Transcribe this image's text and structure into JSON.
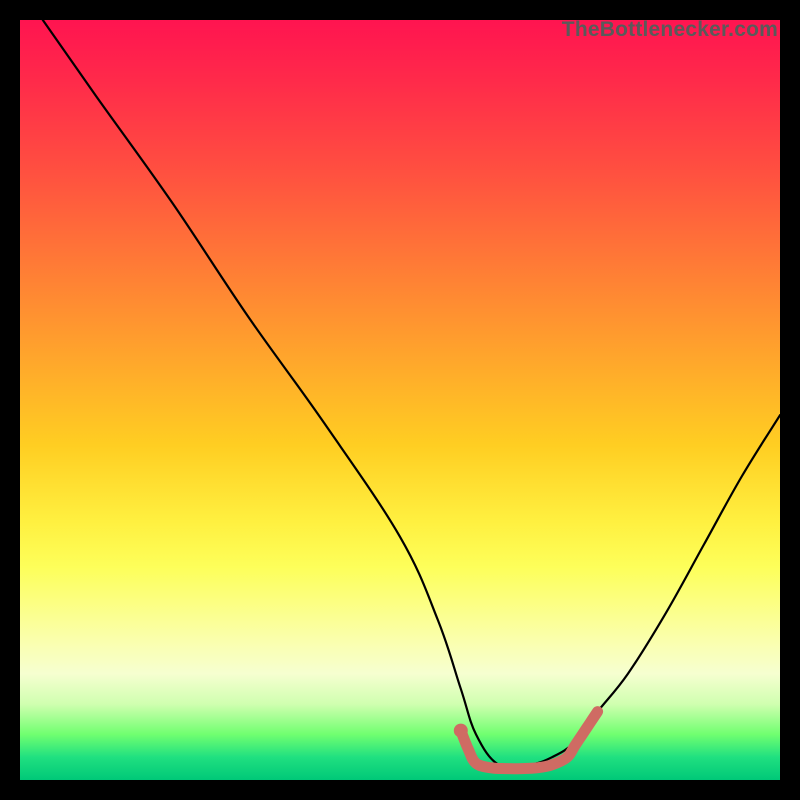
{
  "watermark": "TheBottleneсker.com",
  "chart_data": {
    "type": "line",
    "title": "",
    "xlabel": "",
    "ylabel": "",
    "xlim": [
      0,
      100
    ],
    "ylim": [
      0,
      100
    ],
    "series": [
      {
        "name": "curve",
        "x": [
          3,
          10,
          20,
          30,
          40,
          50,
          55,
          58,
          60,
          63,
          67,
          70,
          73,
          76,
          80,
          85,
          90,
          95,
          100
        ],
        "y": [
          100,
          90,
          76,
          61,
          47,
          32,
          21,
          12,
          6,
          2,
          2,
          3,
          5,
          9,
          14,
          22,
          31,
          40,
          48
        ]
      }
    ],
    "highlight": {
      "name": "optimal-range",
      "color": "#cf6b63",
      "x": [
        58,
        59,
        60,
        62,
        64,
        66,
        68,
        70,
        72,
        73,
        74,
        75,
        76
      ],
      "y": [
        6.5,
        4,
        2.2,
        1.6,
        1.5,
        1.5,
        1.6,
        2.0,
        3.0,
        4.5,
        6.0,
        7.5,
        9.0
      ]
    },
    "highlight_point": {
      "x": 58,
      "y": 6.5,
      "color": "#cf6b63"
    },
    "background_gradient": [
      {
        "stop": 0,
        "color": "#ff1450"
      },
      {
        "stop": 50,
        "color": "#ffce22"
      },
      {
        "stop": 80,
        "color": "#faffb0"
      },
      {
        "stop": 100,
        "color": "#00c878"
      }
    ]
  }
}
